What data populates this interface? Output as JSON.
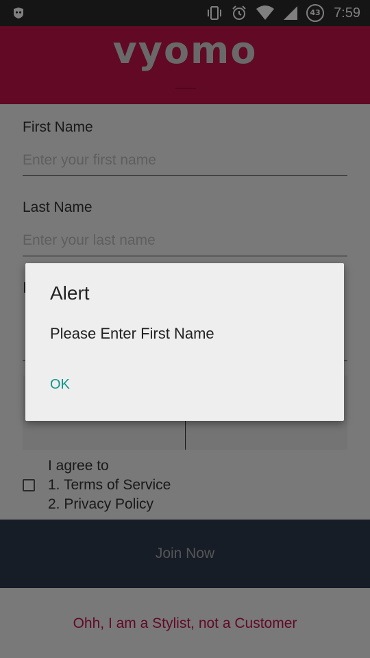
{
  "status_bar": {
    "time": "7:59",
    "battery_level": "43",
    "icons": [
      "app-notification-icon",
      "vibrate-icon",
      "alarm-icon",
      "wifi-icon",
      "cell-signal-icon",
      "battery-icon"
    ]
  },
  "header": {
    "logo_text": "vyomo",
    "background": "#c2124b"
  },
  "form": {
    "first_name_label": "First Name",
    "first_name_placeholder": "Enter your first name",
    "last_name_label": "Last Name",
    "last_name_placeholder": "Enter your last name"
  },
  "agreement": {
    "intro": "I agree to",
    "terms": "1. Terms of Service",
    "privacy": "2. Privacy Policy"
  },
  "buttons": {
    "join": "Join Now",
    "stylist": "Ohh, I am a Stylist, not a Customer"
  },
  "dialog": {
    "title": "Alert",
    "message": "Please Enter First Name",
    "ok": "OK",
    "accent": "#0e958b"
  }
}
